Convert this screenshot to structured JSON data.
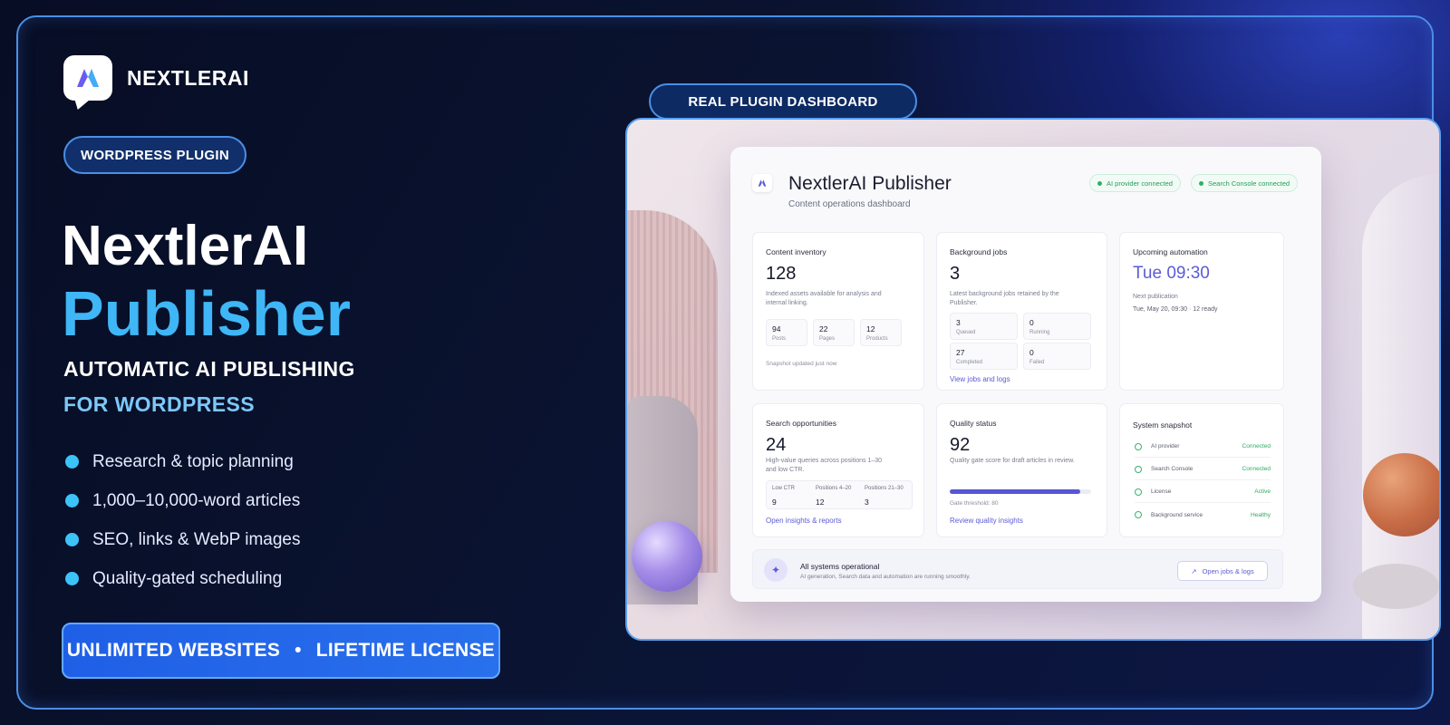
{
  "brand": {
    "name": "NEXTLERAI",
    "logo_glyph": "/\\"
  },
  "badge_plugin": "WORDPRESS PLUGIN",
  "badge_dashboard": "REAL PLUGIN DASHBOARD",
  "headline": {
    "line1": "NextlerAI",
    "line2": "Publisher"
  },
  "subhead": {
    "line1": "AUTOMATIC AI PUBLISHING",
    "line2": "FOR WORDPRESS"
  },
  "features": [
    "Research & topic planning",
    "1,000–10,000-word articles",
    "SEO, links & WebP images",
    "Quality-gated scheduling"
  ],
  "cta": {
    "left": "UNLIMITED WEBSITES",
    "sep": "•",
    "right": "LIFETIME LICENSE"
  },
  "colors": {
    "accent": "#3fb6f6",
    "cta": "#1f5fe6",
    "link": "#5b5bd6",
    "success": "#2eab66"
  },
  "dashboard": {
    "title": "NextlerAI Publisher",
    "subtitle": "Content operations dashboard",
    "chips": [
      "AI provider connected",
      "Search Console connected"
    ],
    "inventory": {
      "title": "Content inventory",
      "value": "128",
      "desc": "Indexed assets available for analysis and internal linking.",
      "stats": [
        {
          "v": "94",
          "l": "Posts"
        },
        {
          "v": "22",
          "l": "Pages"
        },
        {
          "v": "12",
          "l": "Products"
        }
      ],
      "note": "Snapshot updated just now"
    },
    "jobs": {
      "title": "Background jobs",
      "value": "3",
      "desc": "Latest background jobs retained by the Publisher.",
      "stats": [
        {
          "v": "3",
          "l": "Queued"
        },
        {
          "v": "0",
          "l": "Running"
        },
        {
          "v": "27",
          "l": "Completed"
        },
        {
          "v": "0",
          "l": "Failed"
        }
      ],
      "link": "View jobs and logs"
    },
    "automation": {
      "title": "Upcoming automation",
      "value": "Tue 09:30",
      "label": "Next publication",
      "detail": "Tue, May 20, 09:30 · 12 ready"
    },
    "search": {
      "title": "Search opportunities",
      "value": "24",
      "desc": "High-value queries across positions 1–30 and low CTR.",
      "cols": [
        {
          "h": "Low CTR",
          "v": "9"
        },
        {
          "h": "Positions 4–20",
          "v": "12"
        },
        {
          "h": "Positions 21–30",
          "v": "3"
        }
      ],
      "link": "Open insights & reports"
    },
    "quality": {
      "title": "Quality status",
      "value": "92",
      "desc": "Quality gate score for draft articles in review.",
      "progress": 0.92,
      "threshold": "Gate threshold: 80",
      "link": "Review quality insights"
    },
    "system": {
      "title": "System snapshot",
      "rows": [
        {
          "n": "AI provider",
          "s": "Connected"
        },
        {
          "n": "Search Console",
          "s": "Connected"
        },
        {
          "n": "License",
          "s": "Active"
        },
        {
          "n": "Background service",
          "s": "Healthy"
        }
      ]
    },
    "footer": {
      "title": "All systems operational",
      "text": "AI generation, Search data and automation are running smoothly.",
      "button": "Open jobs & logs",
      "button_icon": "trending-up-icon",
      "status_icon": "sparkle-icon"
    }
  }
}
